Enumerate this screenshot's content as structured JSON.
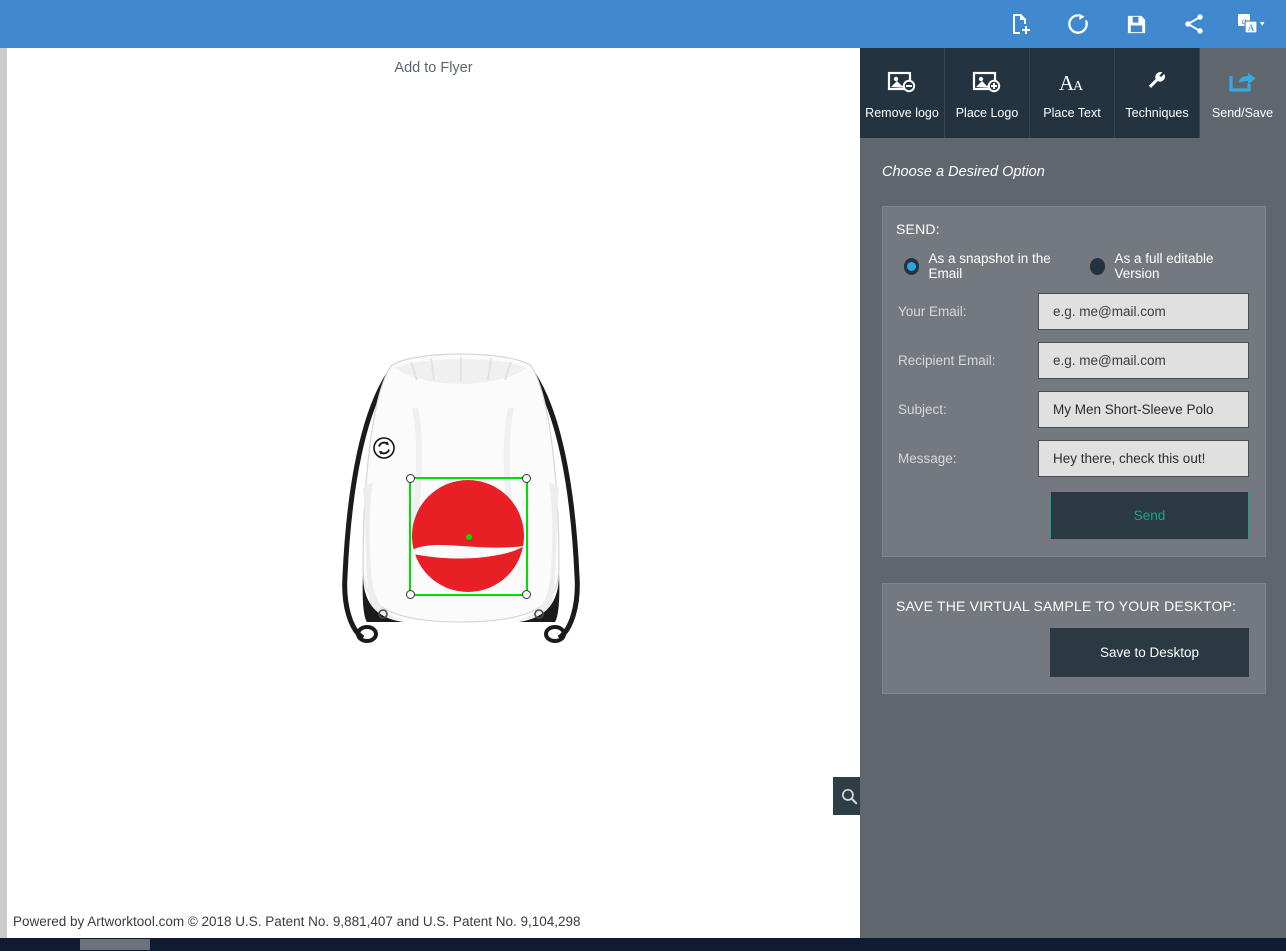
{
  "topbar": {
    "background": "#4189ce",
    "icons": [
      {
        "name": "new-document-icon",
        "label": "New"
      },
      {
        "name": "refresh-icon",
        "label": "Refresh"
      },
      {
        "name": "save-floppy-icon",
        "label": "Save"
      },
      {
        "name": "share-icon",
        "label": "Share"
      },
      {
        "name": "translate-icon",
        "label": "Translate"
      }
    ]
  },
  "canvas": {
    "add_to_flyer_label": "Add to Flyer",
    "zoom_button_icon": "magnifier-icon",
    "product": {
      "type": "drawstring-backpack",
      "color": "#ffffff",
      "cord_color": "#1b1b1b",
      "logo": {
        "shape": "circle-with-swoosh",
        "color": "#e81f24"
      }
    },
    "selection": {
      "border_color": "#00e000",
      "handle_color": "#ffffff",
      "center_dot_color": "#00e000",
      "rotate_icon": "rotate-icon"
    }
  },
  "footer": {
    "text": "Powered by Artworktool.com © 2018 U.S. Patent No. 9,881,407 and U.S. Patent No. 9,104,298"
  },
  "panel": {
    "background": "#5f666d",
    "tabs": [
      {
        "label": "Remove logo",
        "icon": "image-remove-icon",
        "active": false
      },
      {
        "label": "Place Logo",
        "icon": "image-add-icon",
        "active": false
      },
      {
        "label": "Place Text",
        "icon": "text-a-icon",
        "active": false
      },
      {
        "label": "Techniques",
        "icon": "wrench-icon",
        "active": false
      },
      {
        "label": "Send/Save",
        "icon": "share-export-icon",
        "active": true
      }
    ],
    "choose_option_text": "Choose a Desired Option",
    "send": {
      "title": "SEND:",
      "options": [
        {
          "label": "As a snapshot in the Email",
          "selected": true
        },
        {
          "label": "As a full editable Version",
          "selected": false
        }
      ],
      "fields": [
        {
          "label": "Your Email:",
          "value": "e.g. me@mail.com",
          "is_placeholder": true
        },
        {
          "label": "Recipient Email:",
          "value": "e.g. me@mail.com",
          "is_placeholder": true
        },
        {
          "label": "Subject:",
          "value": "My Men Short-Sleeve Polo",
          "is_placeholder": false
        },
        {
          "label": "Message:",
          "value": "Hey there, check this out!",
          "is_placeholder": false
        }
      ],
      "send_button_label": "Send",
      "send_button_color": "#17a589"
    },
    "save": {
      "title": "SAVE THE VIRTUAL SAMPLE TO YOUR DESKTOP:",
      "button_label": "Save to Desktop"
    }
  }
}
